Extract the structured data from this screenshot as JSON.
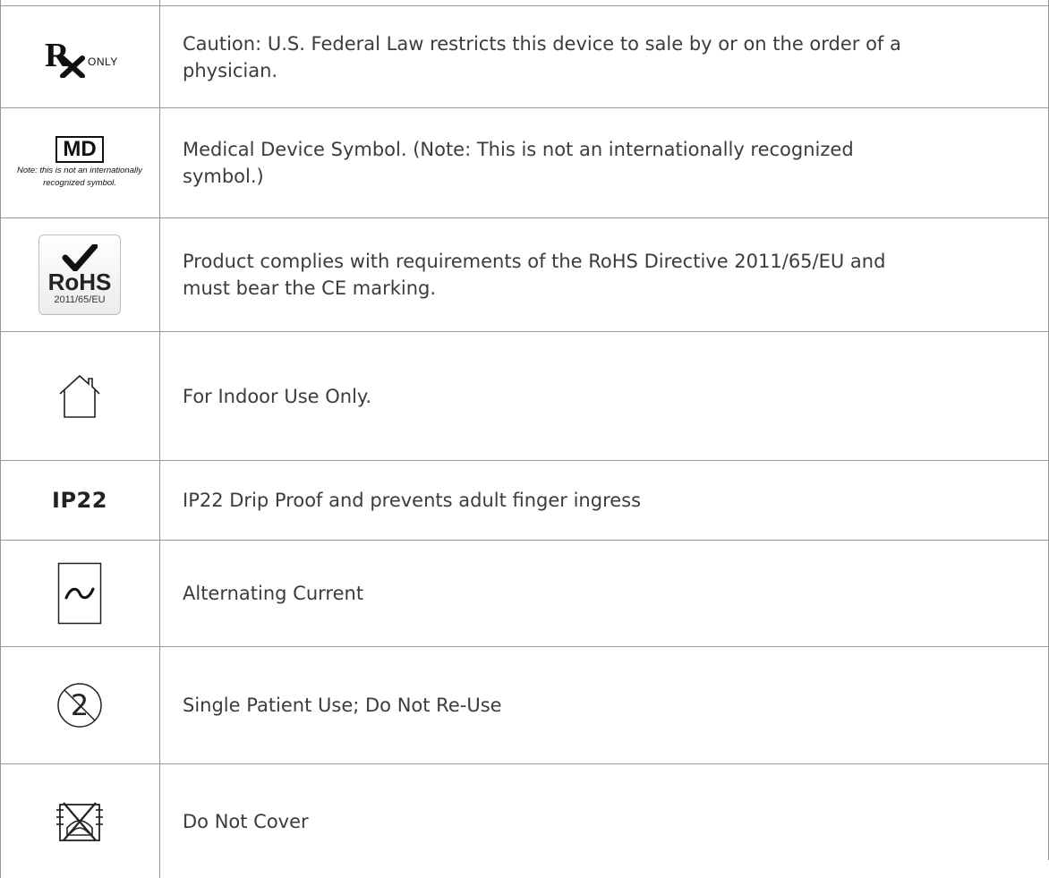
{
  "rows": [
    {
      "symbol": "rx-only-icon",
      "symbol_text": "ONLY",
      "description_lines": [
        "Caution: U.S. Federal Law restricts this device to sale by or on the order of a",
        "physician."
      ]
    },
    {
      "symbol": "md-icon",
      "symbol_text": "MD",
      "symbol_note": "Note: this is not an internationally recognized symbol.",
      "description_lines": [
        "Medical Device Symbol.  (Note: This is not an internationally recognized",
        "symbol.)"
      ]
    },
    {
      "symbol": "rohs-icon",
      "symbol_text": "RoHS",
      "symbol_subtext": "2011/65/EU",
      "description_lines": [
        "Product complies with requirements of the RoHS Directive 2011/65/EU and",
        "must bear the CE marking."
      ]
    },
    {
      "symbol": "house-icon",
      "description_lines": [
        "For Indoor Use Only."
      ]
    },
    {
      "symbol": "ip-rating",
      "symbol_text": "IP22",
      "description_lines": [
        "IP22 Drip Proof and prevents adult finger ingress"
      ]
    },
    {
      "symbol": "alternating-current-icon",
      "description_lines": [
        "Alternating Current"
      ]
    },
    {
      "symbol": "do-not-reuse-icon",
      "description_lines": [
        "Single Patient Use; Do Not Re-Use"
      ]
    },
    {
      "symbol": "do-not-cover-icon",
      "description_lines": [
        "Do Not Cover"
      ]
    }
  ]
}
